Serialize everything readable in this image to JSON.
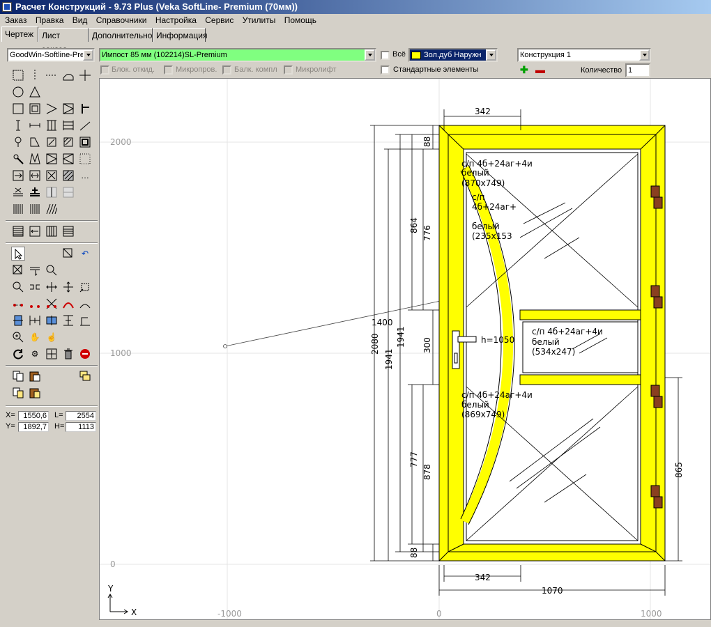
{
  "window": {
    "title": "Расчет Конструкций - 9.73 Plus (Veka SoftLine- Premium (70мм))"
  },
  "menu": [
    "Заказ",
    "Правка",
    "Вид",
    "Справочники",
    "Настройка",
    "Сервис",
    "Утилиты",
    "Помощь"
  ],
  "tabs": [
    "Чертеж",
    "Лист заказа",
    "Дополнительно",
    "Информация"
  ],
  "toolbar": {
    "profile_combo": "GoodWin-Softline-Prem",
    "impost_combo": "Импост  85 мм (102214)SL-Premium",
    "all_label": "Всё",
    "color_combo": "Зол.дуб Наружн",
    "construction_combo": "Конструкция 1",
    "standard_elements_label": "Стандартные элементы",
    "quantity_label": "Количество",
    "quantity_value": "1",
    "disabled_checks": [
      "Блок. откид.",
      "Микропров.",
      "Балк. компл",
      "Микролифт"
    ]
  },
  "coords": {
    "x_label": "X=",
    "x_value": "1550,6",
    "l_label": "L=",
    "l_value": "2554",
    "y_label": "Y=",
    "y_value": "1892,7",
    "h_label": "H=",
    "h_value": "1113"
  },
  "drawing": {
    "grid_labels_y": [
      "2000",
      "1000",
      "0"
    ],
    "grid_labels_x": [
      "-1000",
      "0",
      "1000"
    ],
    "axis_y": "Y",
    "axis_x": "X",
    "dims": {
      "top_342": "342",
      "bottom_342": "342",
      "bottom_1070": "1070",
      "left_2080": "2080",
      "left_1941a": "1941",
      "left_1941b": "1941",
      "left_864": "864",
      "left_776": "776",
      "left_300": "300",
      "left_777": "777",
      "left_878": "878",
      "left_88_top": "88",
      "left_88_bot": "88",
      "right_865": "865",
      "radius_1400": "1400",
      "handle_h": "h=1050"
    },
    "glass": {
      "g1_l1": "с/п 4б+24аг+4и",
      "g1_l2": "белый",
      "g1_l3": "(870x749)",
      "g2_l1": "с/п",
      "g2_l2": "4б+24аг+",
      "g2_l3": "белый",
      "g2_l4": "(235x153",
      "g3_l1": "с/п 4б+24аг+4и",
      "g3_l2": "белый",
      "g3_l3": "(534x247)",
      "g4_l1": "с/п 4б+24аг+4и",
      "g4_l2": "белый",
      "g4_l3": "(869x749)"
    },
    "frame_color": "#ffff00"
  }
}
